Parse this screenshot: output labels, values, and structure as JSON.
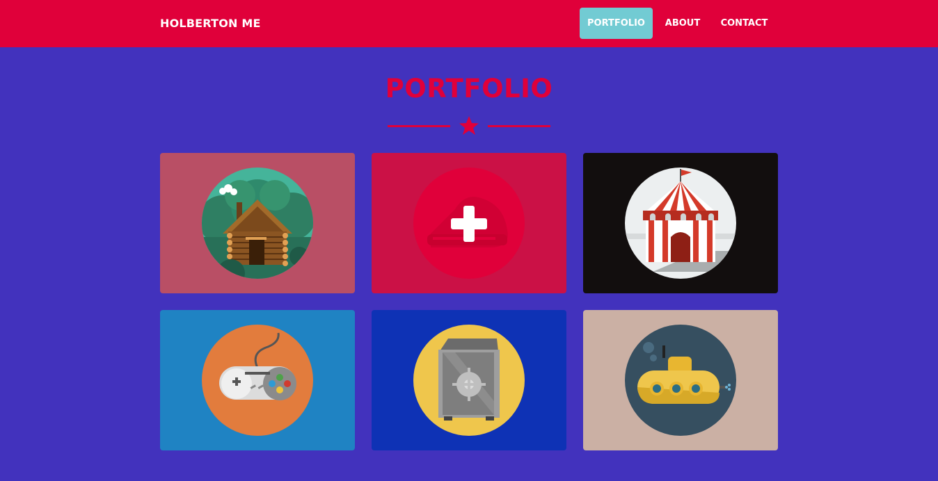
{
  "navbar": {
    "brand": "HOLBERTON ME",
    "links": [
      {
        "label": "PORTFOLIO",
        "active": true
      },
      {
        "label": "ABOUT",
        "active": false
      },
      {
        "label": "CONTACT",
        "active": false
      }
    ]
  },
  "portfolio": {
    "title": "PORTFOLIO",
    "divider_icon": "star-icon",
    "items": [
      {
        "icon": "cabin-icon",
        "background": "#b94f65"
      },
      {
        "icon": "cake-icon",
        "background": "#cb1146"
      },
      {
        "icon": "circus-tent-icon",
        "background": "#120e0e"
      },
      {
        "icon": "game-controller-icon",
        "background": "#1f83c3"
      },
      {
        "icon": "safe-icon",
        "background": "#0e32b5"
      },
      {
        "icon": "submarine-icon",
        "background": "#cbb0a4"
      }
    ]
  },
  "colors": {
    "primary": "#e0003a",
    "accent": "#72cbd3",
    "page_background": "#4232bd"
  }
}
